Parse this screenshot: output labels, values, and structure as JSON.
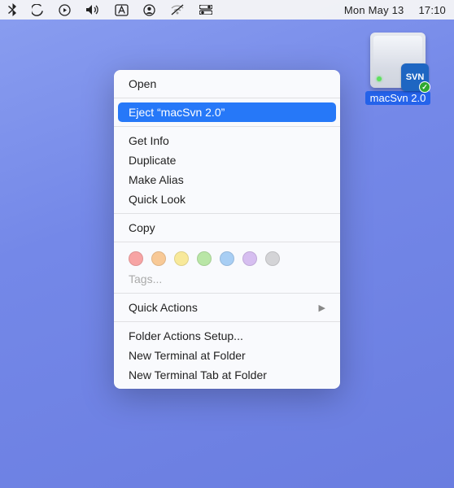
{
  "menubar": {
    "date": "Mon May 13",
    "time": "17:10"
  },
  "disk": {
    "label": "macSvn 2.0",
    "badge": "SVN"
  },
  "context_menu": {
    "open": "Open",
    "eject": "Eject “macSvn 2.0”",
    "get_info": "Get Info",
    "duplicate": "Duplicate",
    "make_alias": "Make Alias",
    "quick_look": "Quick Look",
    "copy": "Copy",
    "tags": "Tags...",
    "quick_actions": "Quick Actions",
    "folder_actions": "Folder Actions Setup...",
    "new_terminal": "New Terminal at Folder",
    "new_terminal_tab": "New Terminal Tab at Folder"
  },
  "tag_colors": [
    "#f7a4a4",
    "#f8c996",
    "#f8e99a",
    "#b9e6a6",
    "#a8cef4",
    "#d6bef0",
    "#d4d4d7"
  ]
}
